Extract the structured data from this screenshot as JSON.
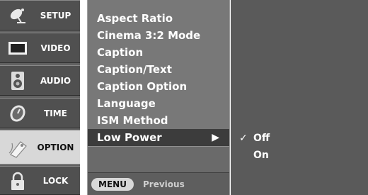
{
  "sidebar": {
    "items": [
      {
        "label": "SETUP",
        "icon": "satellite-dish-icon",
        "active": false
      },
      {
        "label": "VIDEO",
        "icon": "monitor-icon",
        "active": false
      },
      {
        "label": "AUDIO",
        "icon": "speaker-icon",
        "active": false
      },
      {
        "label": "TIME",
        "icon": "clock-icon",
        "active": false
      },
      {
        "label": "OPTION",
        "icon": "option-tag-icon",
        "active": true
      },
      {
        "label": "LOCK",
        "icon": "padlock-icon",
        "active": false
      }
    ]
  },
  "menu": {
    "items": [
      {
        "label": "Aspect Ratio"
      },
      {
        "label": "Cinema 3:2 Mode"
      },
      {
        "label": "Caption"
      },
      {
        "label": "Caption/Text"
      },
      {
        "label": "Caption Option"
      },
      {
        "label": "Language"
      },
      {
        "label": "ISM Method"
      },
      {
        "label": "Low Power",
        "selected": true,
        "arrow": "▶"
      }
    ],
    "footer": {
      "key": "MENU",
      "hint": "Previous"
    }
  },
  "submenu": {
    "items": [
      {
        "label": "Off",
        "checked": true,
        "check": "✓"
      },
      {
        "label": "On",
        "checked": false,
        "check": ""
      }
    ]
  },
  "colors": {
    "sidebar_bg": "#505050",
    "sidebar_active": "#d8d8d8",
    "menu_bg": "#787878",
    "menu_selected": "#3c3c3c",
    "submenu_bg": "#5a5a5a"
  }
}
